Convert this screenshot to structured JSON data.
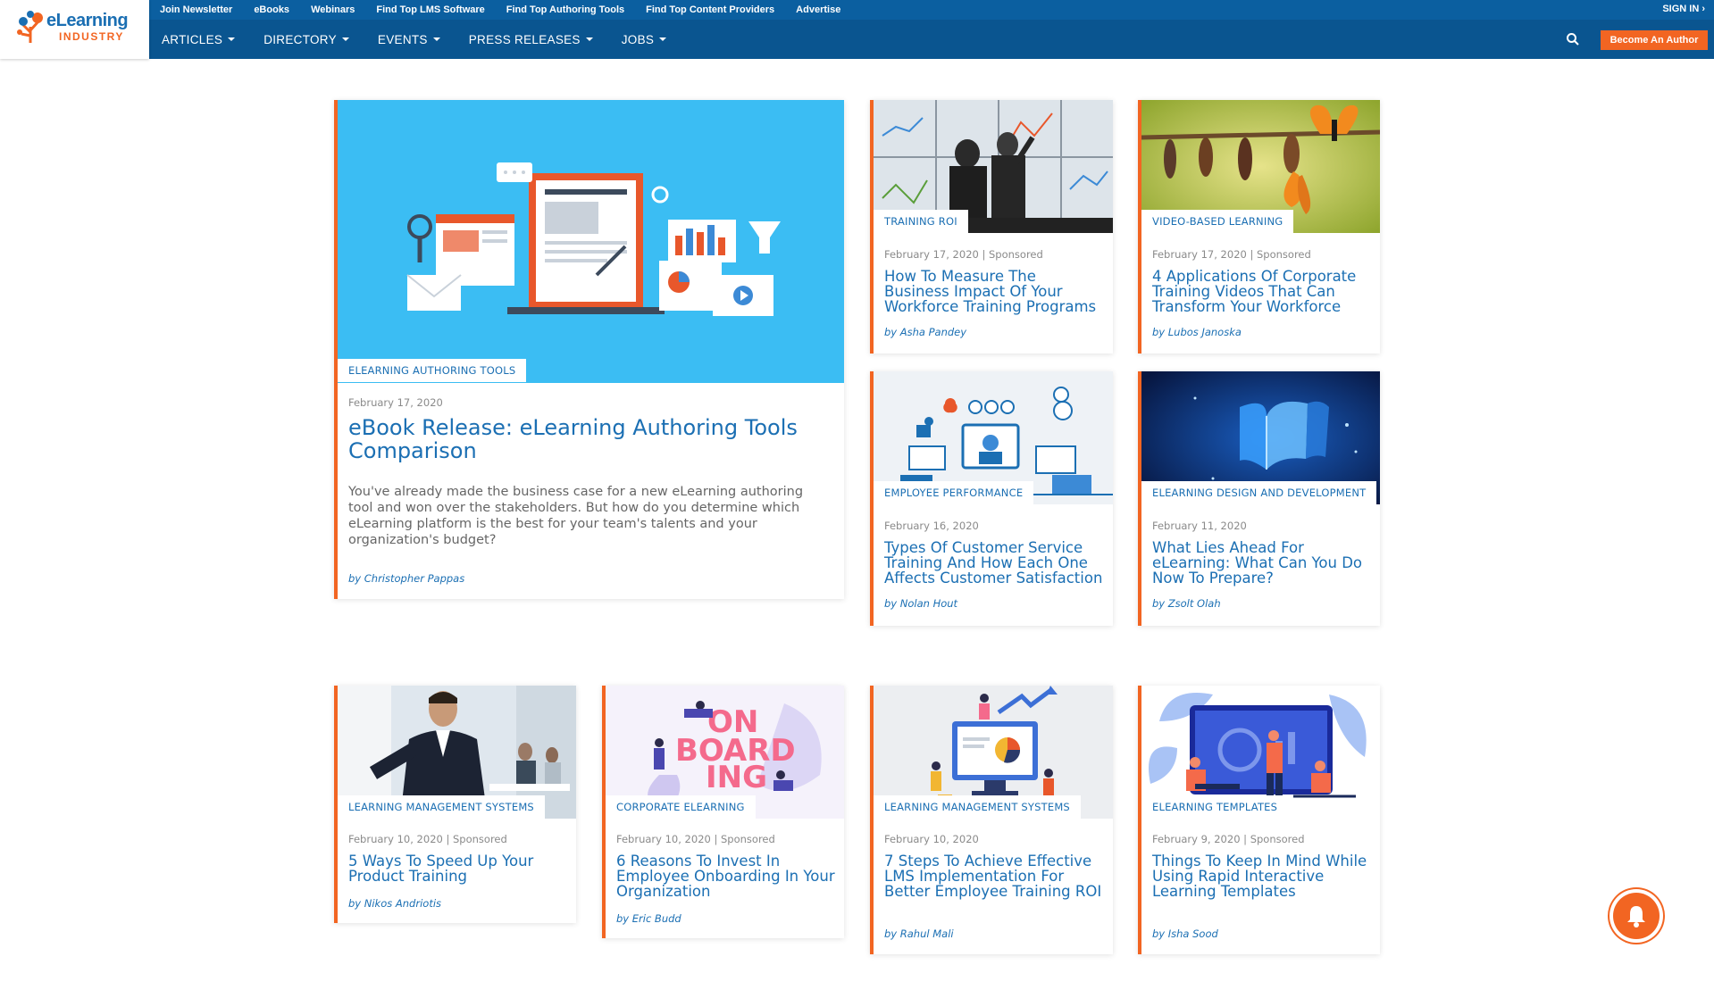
{
  "brand": {
    "logo_line1": "eLearning",
    "logo_line2": "INDUSTRY"
  },
  "topbar": {
    "links": [
      "Join Newsletter",
      "eBooks",
      "Webinars",
      "Find Top LMS Software",
      "Find Top Authoring Tools",
      "Find Top Content Providers",
      "Advertise"
    ],
    "signin": "SIGN IN"
  },
  "nav": {
    "items": [
      "ARTICLES",
      "DIRECTORY",
      "EVENTS",
      "PRESS RELEASES",
      "JOBS"
    ],
    "become_author": "Become An Author"
  },
  "featured": {
    "tag": "ELEARNING AUTHORING TOOLS",
    "date": "February 17, 2020",
    "title": "eBook Release: eLearning Authoring Tools Comparison",
    "excerpt": "You've already made the business case for a new eLearning authoring tool and won over the stakeholders. But how do you determine which eLearning platform is the best for your team's talents and your organization's budget?",
    "author": "by Christopher Pappas"
  },
  "cards": [
    {
      "tag": "TRAINING ROI",
      "meta": "February 17, 2020 | Sponsored",
      "title": "How To Measure The Business Impact Of Your Workforce Training Programs",
      "author": "by Asha Pandey"
    },
    {
      "tag": "VIDEO-BASED LEARNING",
      "meta": "February 17, 2020 | Sponsored",
      "title": "4 Applications Of Corporate Training Videos That Can Transform Your Workforce",
      "author": "by Lubos Janoska"
    },
    {
      "tag": "EMPLOYEE PERFORMANCE",
      "meta": "February 16, 2020",
      "title": "Types Of Customer Service Training And How Each One Affects Customer Satisfaction",
      "author": "by Nolan Hout"
    },
    {
      "tag": "ELEARNING DESIGN AND DEVELOPMENT",
      "meta": "February 11, 2020",
      "title": "What Lies Ahead For eLearning: What Can You Do Now To Prepare?",
      "author": "by Zsolt Olah"
    },
    {
      "tag": "LEARNING MANAGEMENT SYSTEMS",
      "meta": "February 10, 2020 | Sponsored",
      "title": "5 Ways To Speed Up Your Product Training",
      "author": "by Nikos Andriotis"
    },
    {
      "tag": "CORPORATE ELEARNING",
      "meta": "February 10, 2020 | Sponsored",
      "title": "6 Reasons To Invest In Employee Onboarding In Your Organization",
      "author": "by Eric Budd"
    },
    {
      "tag": "LEARNING MANAGEMENT SYSTEMS",
      "meta": "February 10, 2020",
      "title": "7 Steps To Achieve Effective LMS Implementation For Better Employee Training ROI",
      "author": "by Rahul Mali"
    },
    {
      "tag": "ELEARNING TEMPLATES",
      "meta": "February 9, 2020 | Sponsored",
      "title": "Things To Keep In Mind While Using Rapid Interactive Learning Templates",
      "author": "by Isha Sood"
    }
  ],
  "onboarding_art": {
    "line1": "ON",
    "line2": "BOARD",
    "line3": "ING"
  },
  "colors": {
    "brand_blue": "#0a5590",
    "accent_orange": "#f26522",
    "link_blue": "#1b6fb3"
  }
}
